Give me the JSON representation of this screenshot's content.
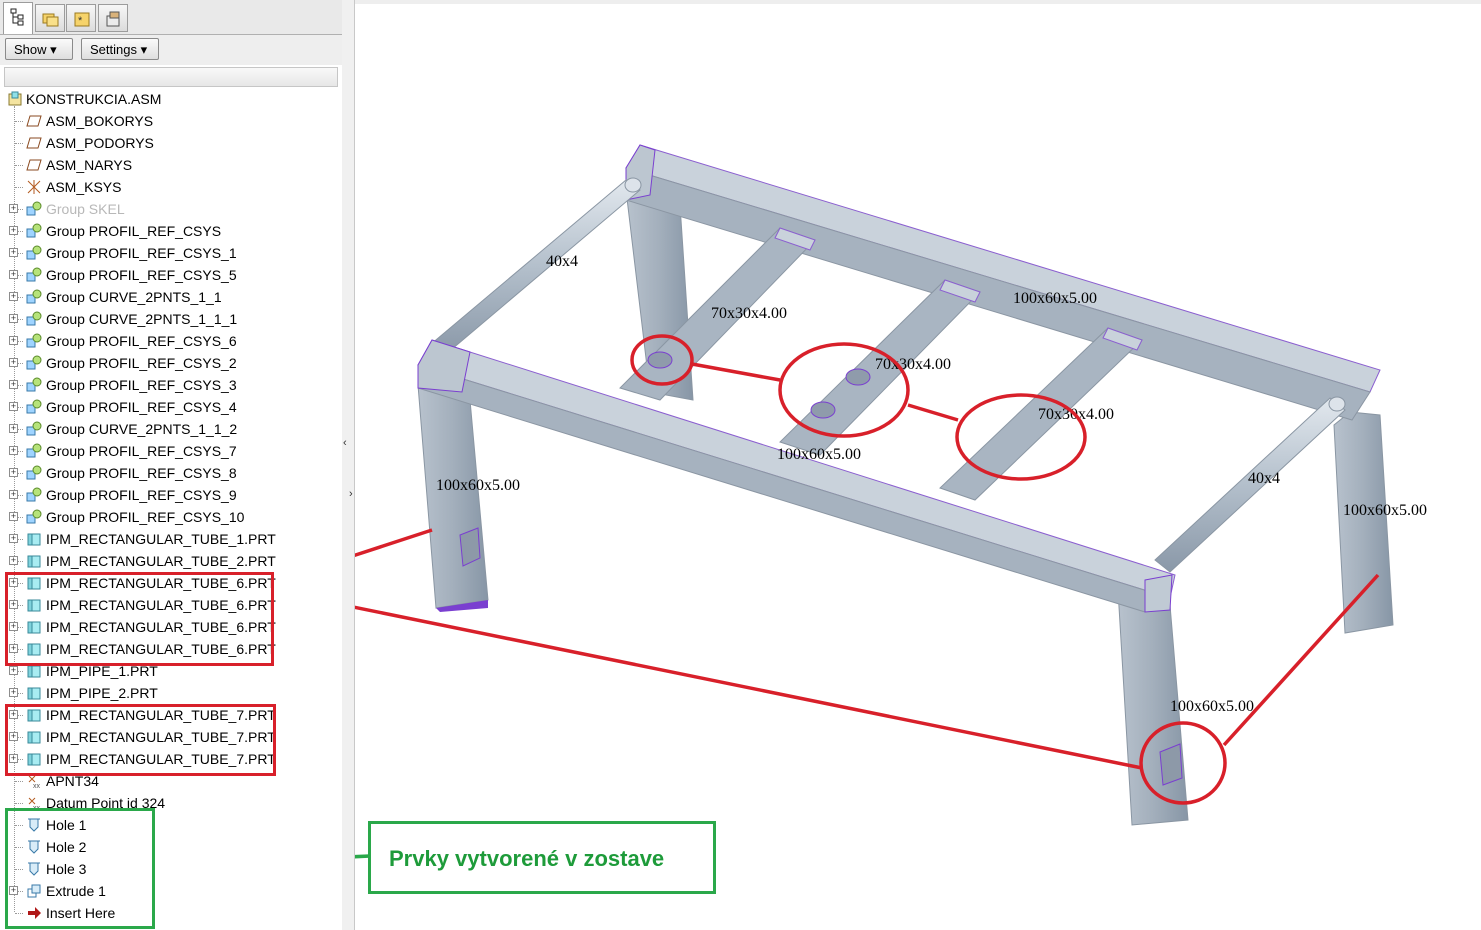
{
  "tabs": [
    {
      "name": "model-tree-tab",
      "icon": "model-tree-icon"
    },
    {
      "name": "folder-browser-tab",
      "icon": "folder-icon"
    },
    {
      "name": "favorites-tab",
      "icon": "favorites-icon"
    },
    {
      "name": "layer-tab",
      "icon": "layers-icon"
    }
  ],
  "toolbar": {
    "show_label": "Show ▾",
    "settings_label": "Settings ▾"
  },
  "tree": [
    {
      "label": "KONSTRUKCIA.ASM",
      "icon": "assembly-icon",
      "root": true
    },
    {
      "label": "ASM_BOKORYS",
      "icon": "datum-plane-icon"
    },
    {
      "label": "ASM_PODORYS",
      "icon": "datum-plane-icon"
    },
    {
      "label": "ASM_NARYS",
      "icon": "datum-plane-icon"
    },
    {
      "label": "ASM_KSYS",
      "icon": "coordinate-system-icon"
    },
    {
      "label": "Group SKEL",
      "icon": "group-icon",
      "expand": true,
      "dim": true
    },
    {
      "label": "Group PROFIL_REF_CSYS",
      "icon": "group-icon",
      "expand": true
    },
    {
      "label": "Group PROFIL_REF_CSYS_1",
      "icon": "group-icon",
      "expand": true
    },
    {
      "label": "Group PROFIL_REF_CSYS_5",
      "icon": "group-icon",
      "expand": true
    },
    {
      "label": "Group CURVE_2PNTS_1_1",
      "icon": "group-icon",
      "expand": true
    },
    {
      "label": "Group CURVE_2PNTS_1_1_1",
      "icon": "group-icon",
      "expand": true
    },
    {
      "label": "Group PROFIL_REF_CSYS_6",
      "icon": "group-icon",
      "expand": true
    },
    {
      "label": "Group PROFIL_REF_CSYS_2",
      "icon": "group-icon",
      "expand": true
    },
    {
      "label": "Group PROFIL_REF_CSYS_3",
      "icon": "group-icon",
      "expand": true
    },
    {
      "label": "Group PROFIL_REF_CSYS_4",
      "icon": "group-icon",
      "expand": true
    },
    {
      "label": "Group CURVE_2PNTS_1_1_2",
      "icon": "group-icon",
      "expand": true
    },
    {
      "label": "Group PROFIL_REF_CSYS_7",
      "icon": "group-icon",
      "expand": true
    },
    {
      "label": "Group PROFIL_REF_CSYS_8",
      "icon": "group-icon",
      "expand": true
    },
    {
      "label": "Group PROFIL_REF_CSYS_9",
      "icon": "group-icon",
      "expand": true
    },
    {
      "label": "Group PROFIL_REF_CSYS_10",
      "icon": "group-icon",
      "expand": true
    },
    {
      "label": "IPM_RECTANGULAR_TUBE_1.PRT",
      "icon": "part-icon",
      "expand": true
    },
    {
      "label": "IPM_RECTANGULAR_TUBE_2.PRT",
      "icon": "part-icon",
      "expand": true
    },
    {
      "label": "IPM_RECTANGULAR_TUBE_6.PRT",
      "icon": "part-icon",
      "expand": true
    },
    {
      "label": "IPM_RECTANGULAR_TUBE_6.PRT",
      "icon": "part-icon",
      "expand": true
    },
    {
      "label": "IPM_RECTANGULAR_TUBE_6.PRT",
      "icon": "part-icon",
      "expand": true
    },
    {
      "label": "IPM_RECTANGULAR_TUBE_6.PRT",
      "icon": "part-icon",
      "expand": true
    },
    {
      "label": "IPM_PIPE_1.PRT",
      "icon": "part-icon",
      "expand": true
    },
    {
      "label": "IPM_PIPE_2.PRT",
      "icon": "part-icon",
      "expand": true
    },
    {
      "label": "IPM_RECTANGULAR_TUBE_7.PRT",
      "icon": "part-icon",
      "expand": true
    },
    {
      "label": "IPM_RECTANGULAR_TUBE_7.PRT",
      "icon": "part-icon",
      "expand": true
    },
    {
      "label": "IPM_RECTANGULAR_TUBE_7.PRT",
      "icon": "part-icon",
      "expand": true
    },
    {
      "label": "APNT34",
      "icon": "datum-point-icon"
    },
    {
      "label": "Datum Point id 324",
      "icon": "datum-point-icon"
    },
    {
      "label": "Hole 1",
      "icon": "hole-icon"
    },
    {
      "label": "Hole 2",
      "icon": "hole-icon"
    },
    {
      "label": "Hole 3",
      "icon": "hole-icon"
    },
    {
      "label": "Extrude 1",
      "icon": "extrude-icon",
      "expand": true
    },
    {
      "label": "Insert Here",
      "icon": "insert-here-arrow-icon"
    }
  ],
  "dimensions": [
    "40x4",
    "70x30x4.00",
    "100x60x5.00",
    "70x30x4.00",
    "70x30x4.00",
    "100x60x5.00",
    "40x4",
    "100x60x5.00",
    "100x60x5.00",
    "100x60x5.00"
  ],
  "callout_text": "Prvky vytvorené v zostave",
  "colors": {
    "red_highlight": "#d8202a",
    "green_highlight": "#2aa84a",
    "steel": "#a9b5c2",
    "edge": "#7a3fd0"
  }
}
